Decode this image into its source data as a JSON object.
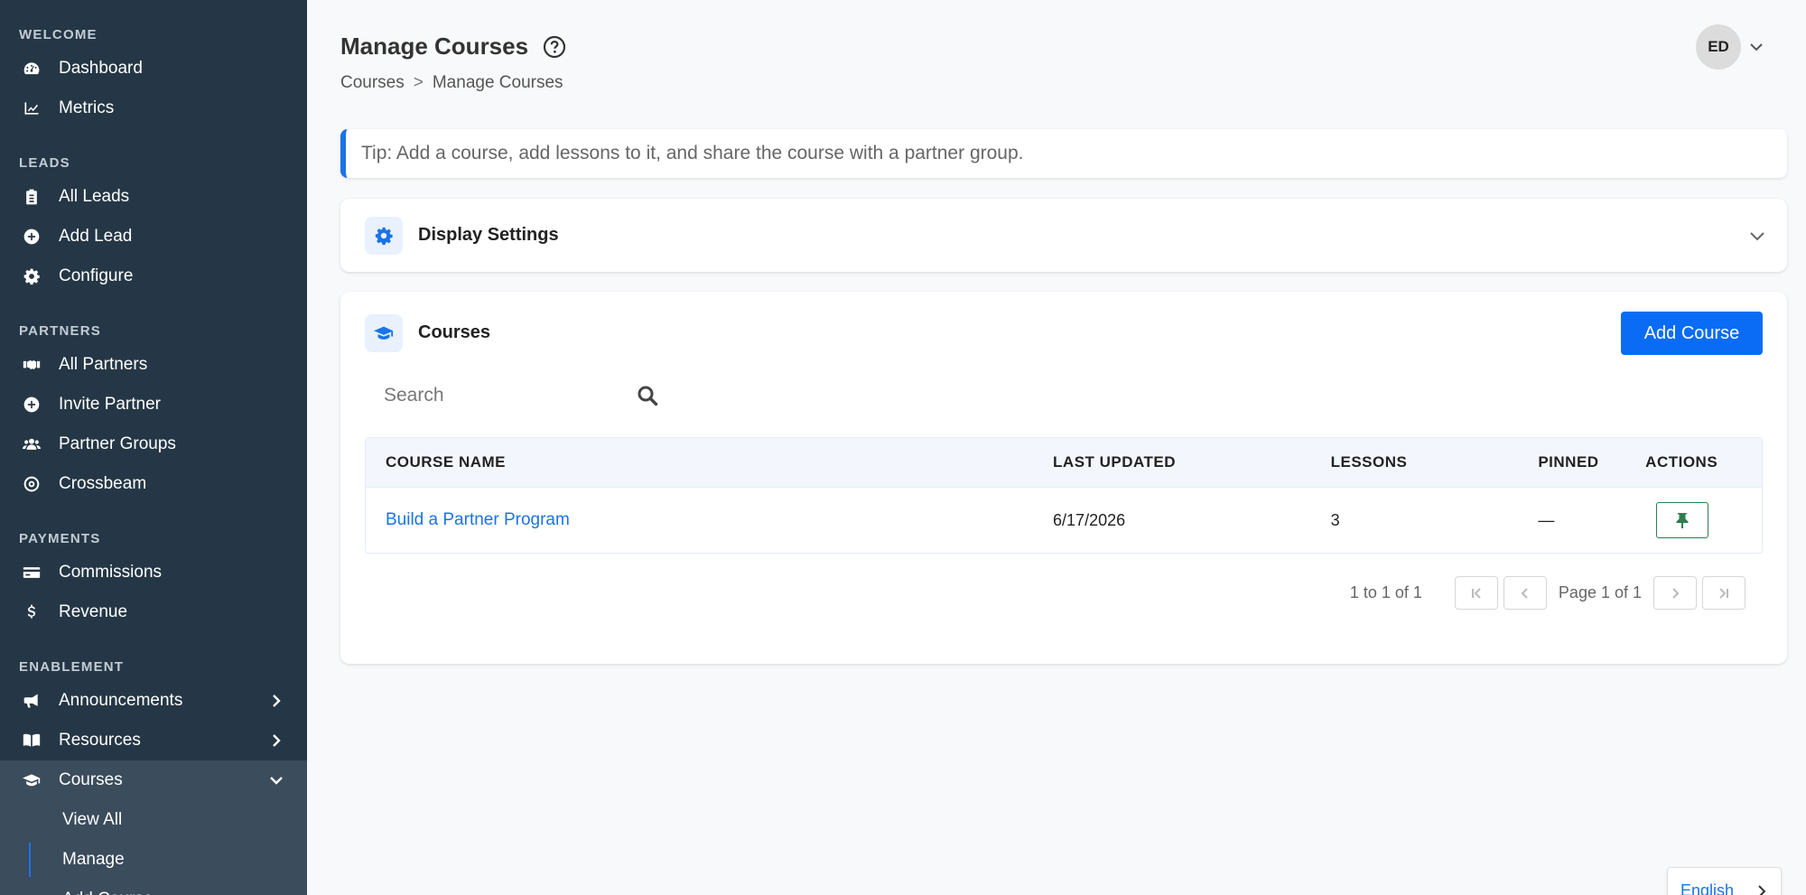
{
  "sidebar": {
    "sections": [
      {
        "title": "WELCOME",
        "items": [
          {
            "label": "Dashboard",
            "icon": "tachometer-icon"
          },
          {
            "label": "Metrics",
            "icon": "chart-line-icon"
          }
        ]
      },
      {
        "title": "LEADS",
        "items": [
          {
            "label": "All Leads",
            "icon": "clipboard-icon"
          },
          {
            "label": "Add Lead",
            "icon": "plus-circle-icon"
          },
          {
            "label": "Configure",
            "icon": "gear-icon"
          }
        ]
      },
      {
        "title": "PARTNERS",
        "items": [
          {
            "label": "All Partners",
            "icon": "handshake-icon"
          },
          {
            "label": "Invite Partner",
            "icon": "plus-circle-icon"
          },
          {
            "label": "Partner Groups",
            "icon": "users-icon"
          },
          {
            "label": "Crossbeam",
            "icon": "target-icon"
          }
        ]
      },
      {
        "title": "PAYMENTS",
        "items": [
          {
            "label": "Commissions",
            "icon": "credit-card-icon"
          },
          {
            "label": "Revenue",
            "icon": "dollar-icon"
          }
        ]
      },
      {
        "title": "ENABLEMENT",
        "items": [
          {
            "label": "Announcements",
            "icon": "megaphone-icon"
          },
          {
            "label": "Resources",
            "icon": "book-icon"
          },
          {
            "label": "Courses",
            "icon": "graduation-cap-icon"
          }
        ]
      }
    ],
    "courses_sub": [
      "View All",
      "Manage",
      "Add Course"
    ]
  },
  "header": {
    "title": "Manage Courses",
    "breadcrumb": [
      "Courses",
      ">",
      "Manage Courses"
    ],
    "avatar_initials": "ED"
  },
  "tip": "Tip: Add a course, add lessons to it, and share the course with a partner group.",
  "display_settings": {
    "title": "Display Settings"
  },
  "courses_card": {
    "title": "Courses",
    "add_button": "Add Course",
    "search_placeholder": "Search",
    "columns": [
      "COURSE NAME",
      "LAST UPDATED",
      "LESSONS",
      "PINNED",
      "ACTIONS"
    ],
    "rows": [
      {
        "name": "Build a Partner Program",
        "updated": "6/17/2026",
        "lessons": "3",
        "pinned": "—"
      }
    ],
    "pager": {
      "range": "1 to 1 of 1",
      "page": "Page 1 of 1"
    }
  },
  "language": "English",
  "colors": {
    "sidebar": "#253746",
    "accent": "#0a6cf5",
    "pin": "#2e7d4f"
  }
}
